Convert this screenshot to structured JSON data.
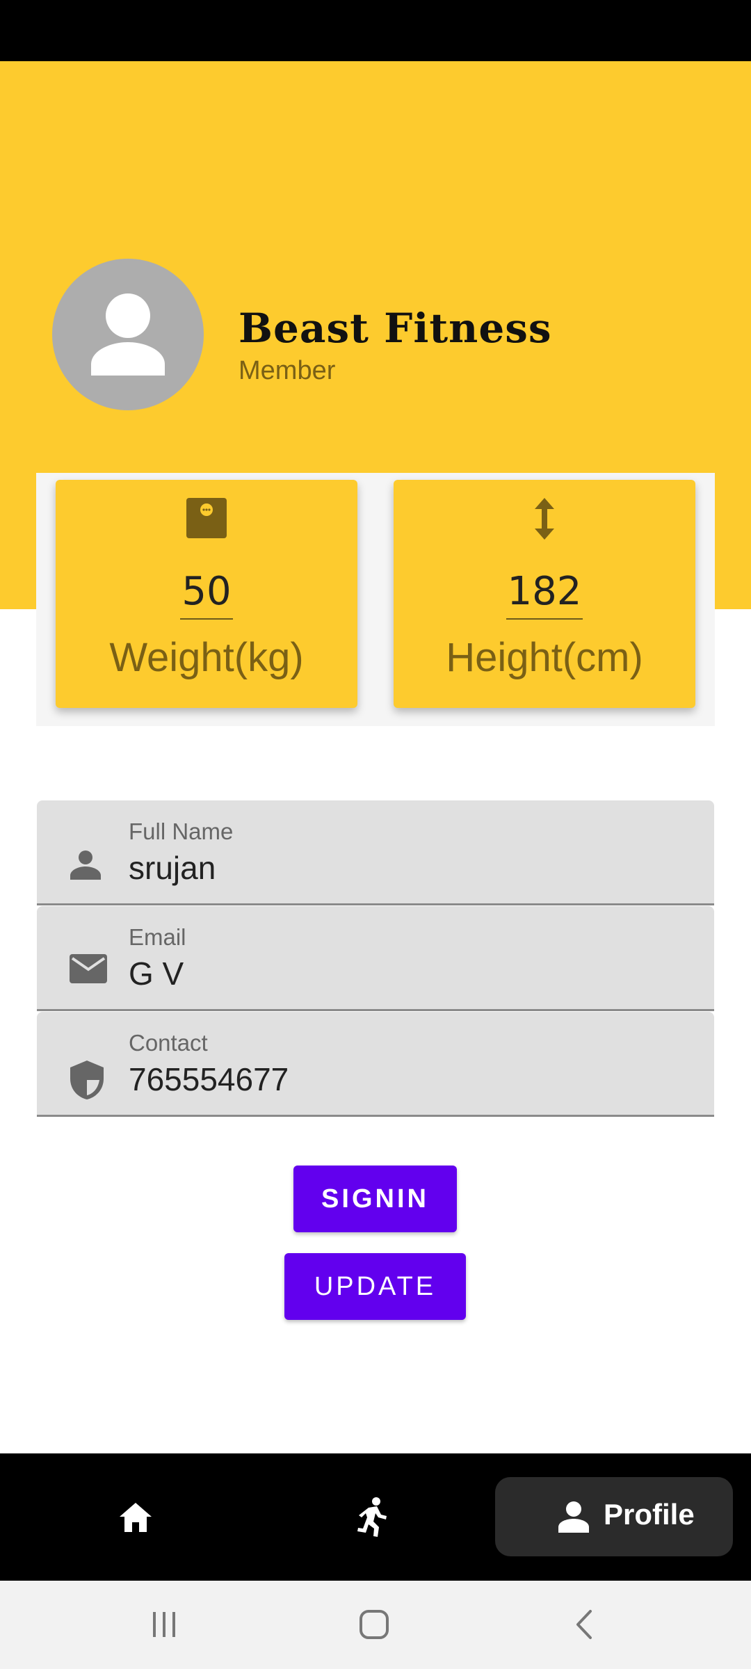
{
  "header": {
    "app_title": "Beast Fitness",
    "subtitle": "Member",
    "background_color": "#FDCB2E"
  },
  "stats": [
    {
      "icon": "scale-icon",
      "value": "50",
      "label": "Weight(kg)"
    },
    {
      "icon": "vertical-arrows-icon",
      "value": "182",
      "label": "Height(cm)"
    }
  ],
  "form": {
    "fields": [
      {
        "icon": "person-icon",
        "label": "Full Name",
        "value": "srujan"
      },
      {
        "icon": "email-icon",
        "label": "Email",
        "value": "G V"
      },
      {
        "icon": "shield-icon",
        "label": "Contact",
        "value": "765554677"
      }
    ]
  },
  "buttons": {
    "signin_label": "SIGNIN",
    "update_label": "UPDATE",
    "color": "#6200EE"
  },
  "bottom_nav": {
    "items": [
      {
        "icon": "home-icon",
        "label": ""
      },
      {
        "icon": "running-icon",
        "label": ""
      },
      {
        "icon": "person-icon",
        "label": "Profile",
        "selected": true
      }
    ]
  },
  "system_nav": {
    "items": [
      "recent-apps-icon",
      "home-circle-icon",
      "back-icon"
    ]
  }
}
